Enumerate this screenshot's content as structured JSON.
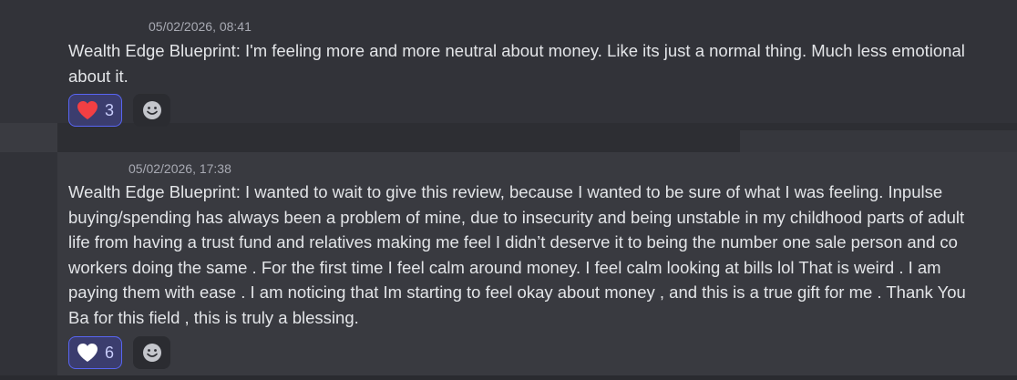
{
  "messages": [
    {
      "timestamp": "05/02/2026, 08:41",
      "lines": [
        "Wealth Edge Blueprint: I'm feeling more and more neutral about money. Like its just a normal thing. Much less emotional",
        "about it."
      ],
      "reaction": {
        "icon": "red-heart-icon",
        "count": "3",
        "color": "#f23f43"
      },
      "add_reaction_icon": "smile-icon"
    },
    {
      "timestamp": "05/02/2026, 17:38",
      "lines": [
        "Wealth Edge Blueprint: I wanted to wait to give this review, because I wanted to be sure of what I was feeling. Inpulse",
        "buying/spending has always been a problem of mine, due to insecurity and being unstable in my childhood parts of adult",
        "life from having a trust fund and relatives making me feel I didn’t deserve it  to being the number one sale person and co",
        "workers doing the same . For the first time I feel calm around money. I feel calm looking at bills lol That is weird . I am",
        "paying them with ease .  I am noticing that Im starting to feel okay about money , and this is a true gift for me . Thank You",
        "Ba for this field , this is truly a blessing."
      ],
      "reaction": {
        "icon": "white-heart-icon",
        "count": "6",
        "color": "#ffffff"
      },
      "add_reaction_icon": "smile-icon"
    }
  ],
  "colors": {
    "accent": "#5865f2",
    "reaction_bg": "#3b3d6e"
  }
}
